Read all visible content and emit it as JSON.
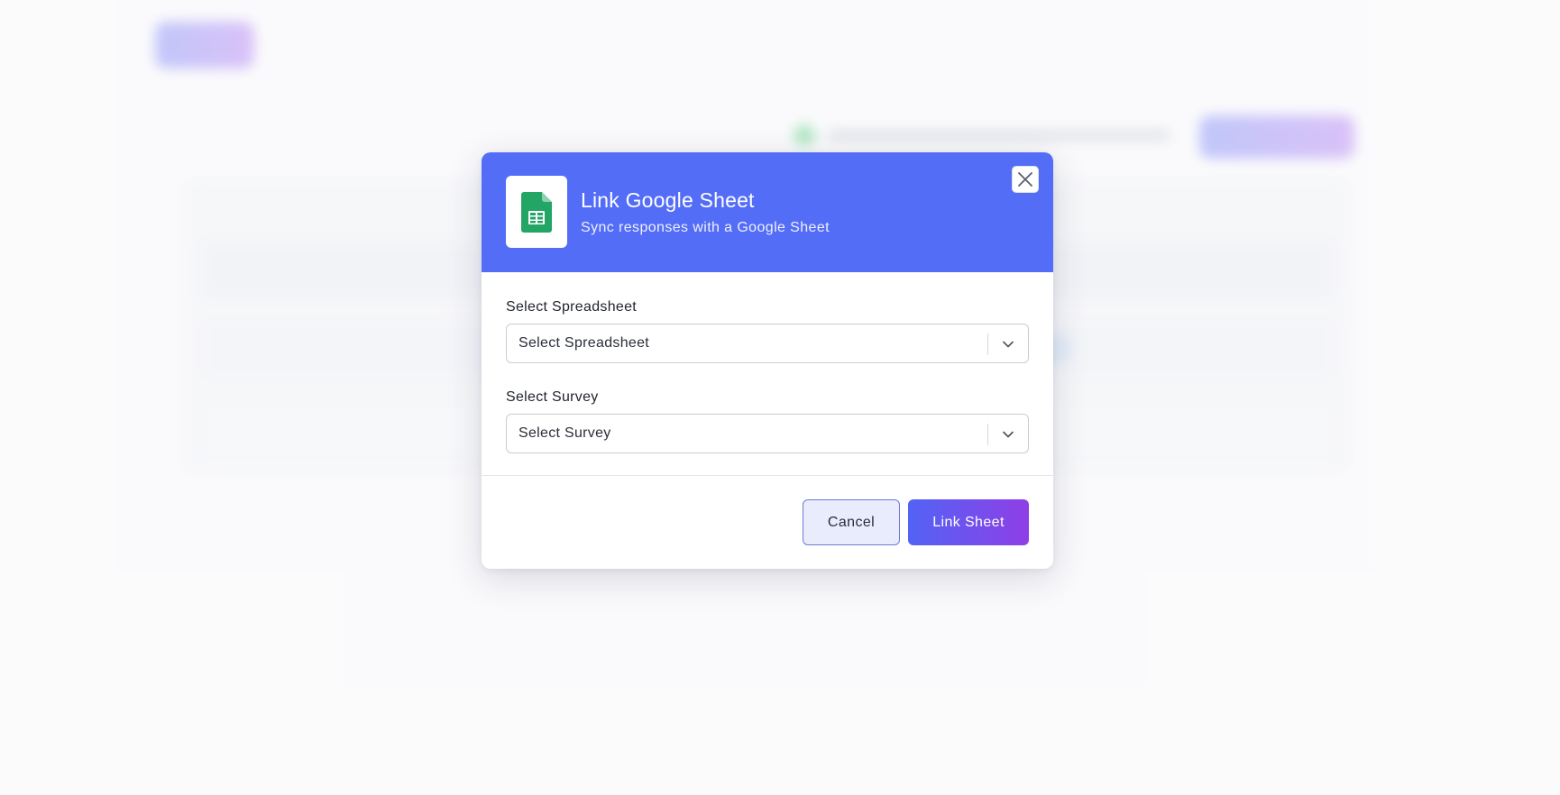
{
  "modal": {
    "title": "Link Google Sheet",
    "subtitle": "Sync responses with a Google Sheet",
    "header_color": "#536df7",
    "icon": "google-sheets-icon",
    "close_icon": "close-icon"
  },
  "form": {
    "spreadsheet": {
      "label": "Select Spreadsheet",
      "value": "Select Spreadsheet",
      "icon": "chevron-down-icon"
    },
    "survey": {
      "label": "Select Survey",
      "value": "Select Survey",
      "icon": "chevron-down-icon"
    }
  },
  "footer": {
    "cancel_label": "Cancel",
    "submit_label": "Link Sheet",
    "submit_gradient": [
      "#5263f5",
      "#8f3fe6"
    ]
  }
}
